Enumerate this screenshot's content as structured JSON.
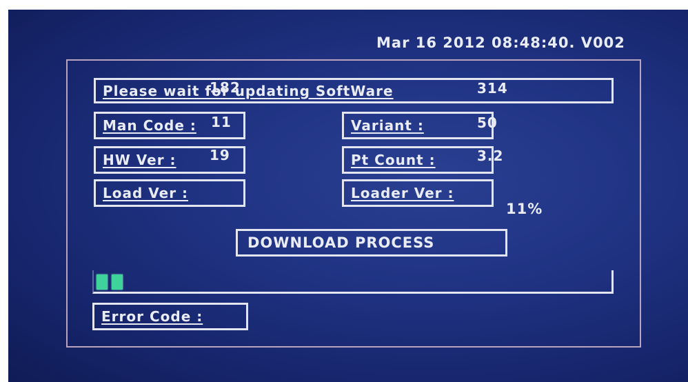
{
  "header": {
    "timestamp_version": "Mar 16 2012 08:48:40. V002"
  },
  "status": {
    "message": "Please wait for updating SoftWare"
  },
  "info": {
    "man_code_label": "Man Code :",
    "man_code_value": "182",
    "hw_ver_label": "HW Ver :",
    "hw_ver_value": "11",
    "load_ver_label": "Load Ver :",
    "load_ver_value": "19",
    "variant_label": "Variant :",
    "variant_value": "314",
    "pt_count_label": "Pt Count :",
    "pt_count_value": "50",
    "loader_ver_label": "Loader Ver :",
    "loader_ver_value": "3.2"
  },
  "download": {
    "label": "DOWNLOAD PROCESS",
    "percent_text": "11%",
    "progress_fraction": 0.11,
    "filled_blocks": 2,
    "fill_color": "#3ed39a"
  },
  "error": {
    "label": "Error Code :"
  },
  "colors": {
    "background": "#1f3282",
    "text": "#e9ecf5",
    "frame": "#b9a3bd"
  }
}
